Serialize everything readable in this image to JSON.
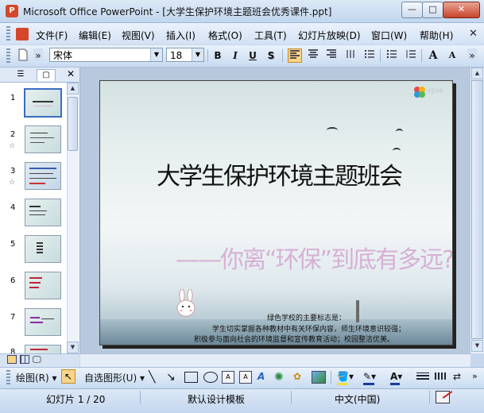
{
  "window": {
    "title": "Microsoft Office PowerPoint - [大学生保护环境主题班会优秀课件.ppt]",
    "min_glyph": "—",
    "max_glyph": "□",
    "close_glyph": "✕"
  },
  "menu": {
    "items": [
      "文件(F)",
      "编辑(E)",
      "视图(V)",
      "插入(I)",
      "格式(O)",
      "工具(T)",
      "幻灯片放映(D)",
      "窗口(W)",
      "帮助(H)"
    ],
    "close_glyph": "✕"
  },
  "format_toolbar": {
    "font_name": "宋体",
    "font_size": "18",
    "bold": "B",
    "italic": "I",
    "underline": "U",
    "shadow": "S",
    "grow_font": "A",
    "shrink_font": "A"
  },
  "slide_pane": {
    "slides": [
      "1",
      "2",
      "3",
      "4",
      "5",
      "6",
      "7",
      "8"
    ],
    "star_glyph": "☆"
  },
  "slide": {
    "title": "大学生保护环境主题班会",
    "subtitle": "——你离“环保”到底有多远?",
    "lines": [
      "绿色学校的主要标志是：",
      "学生切实掌握各种教材中有关环保内容，师生环境意识较强；",
      "积极参与面向社会的环境监督和宣传教育活动；校园整洁优美。"
    ],
    "logo_text": "汉豆文库",
    "colors": {
      "title": "#111111",
      "subtitle": "#d7b0d6"
    }
  },
  "drawing_toolbar": {
    "draw_label": "绘图(R)",
    "autoshapes_label": "自选图形(U)"
  },
  "status": {
    "slide_position": "幻灯片 1 / 20",
    "template": "默认设计模板",
    "language": "中文(中国)"
  }
}
